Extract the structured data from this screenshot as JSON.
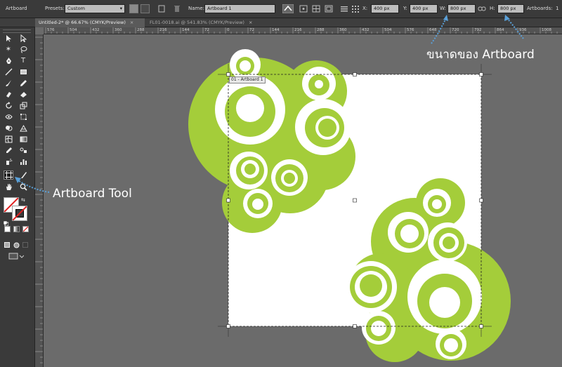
{
  "control_bar": {
    "tool_name": "Artboard",
    "presets_label": "Presets:",
    "presets_value": "Custom",
    "name_label": "Name:",
    "name_value": "Artboard 1",
    "x_label": "X:",
    "x_value": "400 px",
    "y_label": "Y:",
    "y_value": "400 px",
    "w_label": "W:",
    "w_value": "800 px",
    "h_label": "H:",
    "h_value": "800 px",
    "artboards_label": "Artboards:",
    "artboards_value": "1"
  },
  "tabs": [
    {
      "label": "Untitled-2* @ 66.67% (CMYK/Preview)",
      "close": "×"
    },
    {
      "label": "FL01-0018.ai @ 541.83% (CMYK/Preview)",
      "close": "×"
    }
  ],
  "ruler": {
    "top": [
      "576",
      "504",
      "432",
      "360",
      "288",
      "216",
      "144",
      "72",
      "0",
      "72",
      "144",
      "216",
      "288",
      "360",
      "432",
      "504",
      "576",
      "648",
      "720",
      "792",
      "864",
      "936",
      "1008"
    ]
  },
  "artboard": {
    "label": "01 - Artboard 1"
  },
  "annotations": {
    "size": "ขนาดของ Artboard",
    "tool": "Artboard Tool"
  },
  "colors": {
    "app_bg": "#3a3a3a",
    "canvas_bg": "#6b6b6b",
    "artwork_green": "#a4cd3a",
    "annotation_arrow": "#5aa0d8",
    "stroke_red": "#e02020"
  }
}
